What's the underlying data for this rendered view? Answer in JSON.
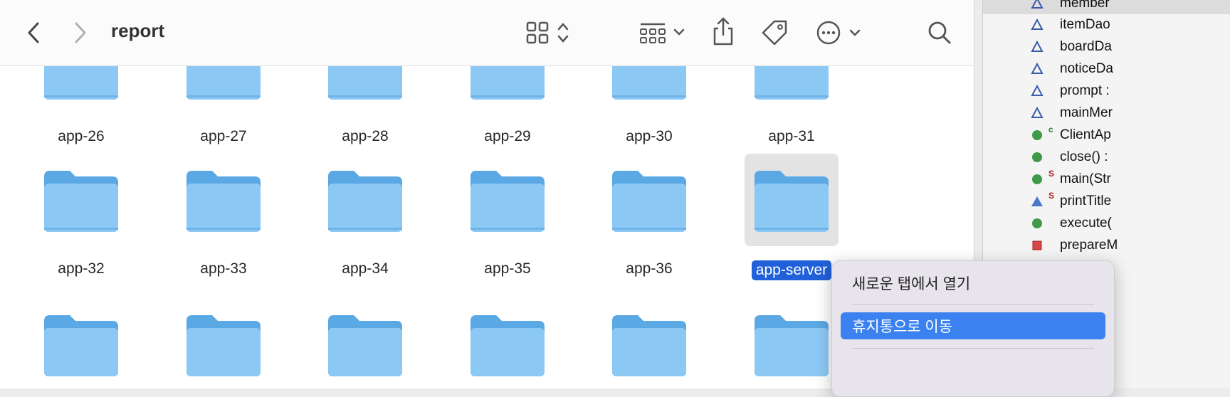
{
  "window": {
    "title": "report"
  },
  "toolbar": {
    "back": "chevron-left-icon",
    "forward": "chevron-right-icon",
    "view": "grid-view-icon",
    "group": "group-by-icon",
    "share": "share-icon",
    "tag": "tag-icon",
    "more": "more-icon",
    "search": "search-icon"
  },
  "folders": {
    "row1": [
      "app-26",
      "app-27",
      "app-28",
      "app-29",
      "app-30",
      "app-31"
    ],
    "row2": [
      "app-32",
      "app-33",
      "app-34",
      "app-35",
      "app-36",
      "app-server"
    ]
  },
  "selected_folder": "app-server",
  "ide": {
    "rows": [
      {
        "icon": "field-icon",
        "text": "member"
      },
      {
        "icon": "field-icon",
        "text": "itemDao"
      },
      {
        "icon": "field-icon",
        "text": "boardDa"
      },
      {
        "icon": "field-icon",
        "text": "noticeDa"
      },
      {
        "icon": "field-icon",
        "text": "prompt :"
      },
      {
        "icon": "field-icon",
        "text": "mainMer"
      },
      {
        "icon": "method-icon",
        "text": "ClientAp",
        "sup": "c"
      },
      {
        "icon": "method-icon",
        "text": "close() :"
      },
      {
        "icon": "method-icon",
        "text": "main(Str",
        "sup": "S"
      },
      {
        "icon": "protected-icon",
        "text": "printTitle",
        "sup": "S"
      },
      {
        "icon": "method-icon",
        "text": "execute("
      },
      {
        "icon": "private-icon",
        "text": "prepareM"
      }
    ]
  },
  "context_menu": {
    "items": [
      "새로운 탭에서 열기",
      "휴지통으로 이동"
    ],
    "active_index": 1
  },
  "colors": {
    "folder": "#8cc8f4",
    "folder_tab": "#5aa8e4",
    "selection": "#2060d8",
    "menu_active": "#3b82f0"
  }
}
